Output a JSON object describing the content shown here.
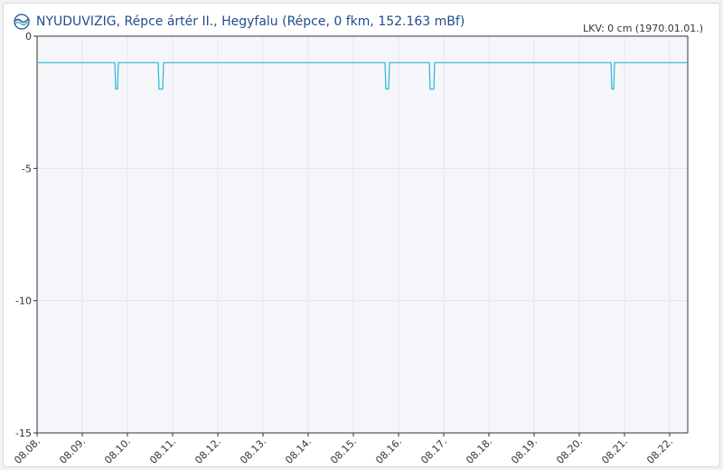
{
  "title": "NYUDUVIZIG, Répce ártér II., Hegyfalu (Répce, 0 fkm, 152.163 mBf)",
  "logo_icon": "water-wave-logo-icon",
  "colors": {
    "line": "#2bb5d8",
    "plot_bg": "#f4f6fa",
    "grid": "#e3e6ea",
    "axis": "#333333",
    "title": "#1f4e8c"
  },
  "chart_data": {
    "type": "line",
    "lkv_label": "LKV: 0 cm (1970.01.01.)",
    "ylim": [
      -15,
      0
    ],
    "yticks": [
      0,
      -5,
      -10,
      -15
    ],
    "ytick_labels": [
      "0",
      "-5",
      "-10",
      "-15"
    ],
    "xlim": [
      0,
      14.4
    ],
    "x_tick_labels": [
      "08.08.",
      "08.09.",
      "08.10.",
      "08.11.",
      "08.12.",
      "08.13.",
      "08.14.",
      "08.15.",
      "08.16.",
      "08.17.",
      "08.18.",
      "08.19.",
      "08.20.",
      "08.21.",
      "08.22."
    ],
    "grid": true,
    "series": [
      {
        "x": [
          0,
          1.72,
          1.74,
          1.78,
          1.8,
          2.68,
          2.7,
          2.78,
          2.8,
          7.7,
          7.72,
          7.78,
          7.8,
          8.68,
          8.7,
          8.78,
          8.8,
          12.7,
          12.72,
          12.76,
          12.78,
          14.4
        ],
        "y": [
          -1,
          -1,
          -2,
          -2,
          -1,
          -1,
          -2,
          -2,
          -1,
          -1,
          -2,
          -2,
          -1,
          -1,
          -2,
          -2,
          -1,
          -1,
          -2,
          -2,
          -1,
          -1
        ]
      }
    ]
  }
}
